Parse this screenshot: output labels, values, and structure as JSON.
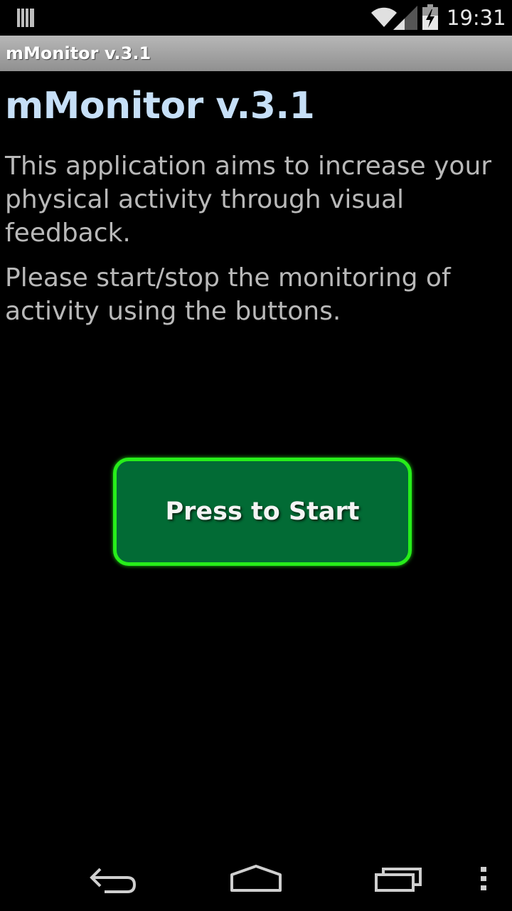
{
  "status_bar": {
    "time": "19:31",
    "icons": [
      "notification-icon",
      "wifi-icon",
      "signal-icon",
      "battery-charging-icon"
    ]
  },
  "title_bar": {
    "title": "mMonitor v.3.1"
  },
  "main": {
    "heading": "mMonitor v.3.1",
    "paragraphs": [
      "This application aims to increase your physical activity through visual feedback.",
      "Please start/stop the monitoring of activity using the buttons."
    ],
    "start_button_label": "Press to Start"
  },
  "nav_bar": {
    "icons": [
      "back-icon",
      "home-icon",
      "recent-apps-icon",
      "overflow-menu-icon"
    ]
  },
  "colors": {
    "heading": "#c6dff7",
    "body_text": "#b9b9b9",
    "button_fill": "#026b35",
    "button_border": "#27ee1a",
    "background": "#000000"
  }
}
